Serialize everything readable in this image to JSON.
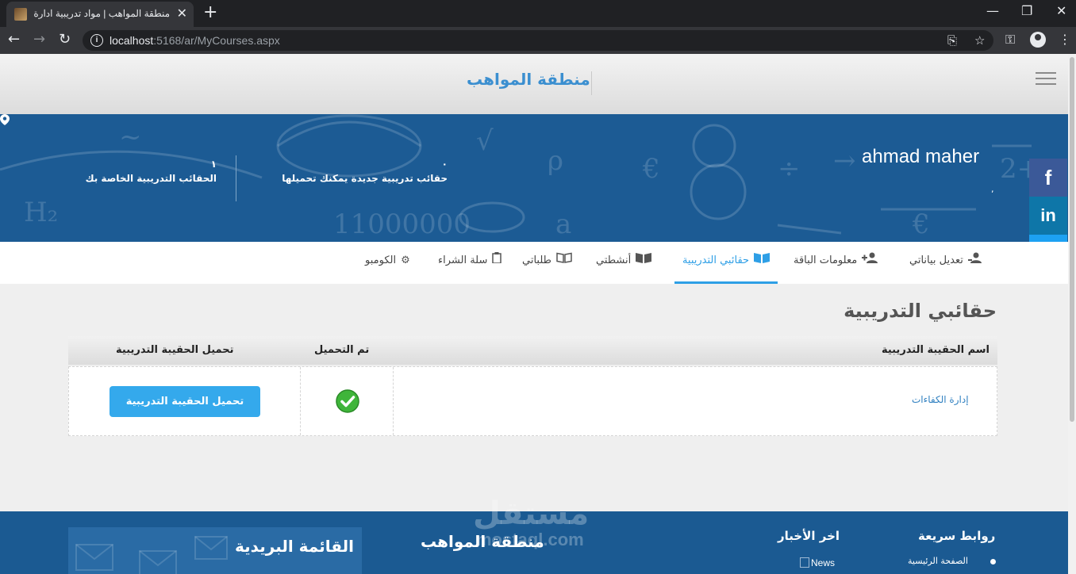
{
  "browser": {
    "tab_title": "منطقة المواهب | مواد تدريبية ادارة",
    "tab_close": "✕",
    "new_tab": "+",
    "url_host": "localhost",
    "url_rest": ":5168/ar/MyCourses.aspx",
    "window_controls": {
      "minimize": "—",
      "maximize": "❐",
      "close": "✕"
    },
    "nav": {
      "back": "←",
      "forward": "→",
      "reload": "↻"
    }
  },
  "site": {
    "logo": "منطقة المواهب"
  },
  "profile": {
    "name": "ahmad maher",
    "location": ",",
    "stats": [
      {
        "value": "٠",
        "label": "حقائب تدريبية جديدة يمكنك تحميلها"
      },
      {
        "value": "١",
        "label": "الحقائب التدريبية الخاصة بك"
      }
    ]
  },
  "social": {
    "facebook": "f",
    "linkedin": "in"
  },
  "nav_tabs": [
    {
      "label": "تعديل بياناتي",
      "icon": "user-edit-icon",
      "active": false
    },
    {
      "label": "معلومات الباقة",
      "icon": "user-plus-icon",
      "active": false
    },
    {
      "label": "حقائبي التدريبية",
      "icon": "open-book-icon",
      "active": true
    },
    {
      "label": "أنشطتي",
      "icon": "book-icon",
      "active": false
    },
    {
      "label": "طلباتي",
      "icon": "book-outline-icon",
      "active": false
    },
    {
      "label": "سلة الشراء",
      "icon": "clipboard-icon",
      "active": false
    },
    {
      "label": "الكومبو",
      "icon": "gear-icon",
      "active": false
    }
  ],
  "main": {
    "title": "حقائبي التدريبية",
    "table": {
      "headers": [
        "اسم الحقيبة التدريبية",
        "تم التحميل",
        "تحميل الحقيبة التدريبية"
      ],
      "rows": [
        {
          "course": "إدارة الكفاءات",
          "downloaded": true,
          "action": "تحميل الحقيبة التدريبية"
        }
      ]
    }
  },
  "footer": {
    "quick_links_title": "روابط سريعة",
    "quick_links": [
      "الصفحة الرئيسية"
    ],
    "news_title": "اخر الأخبار",
    "news_image_alt": "News",
    "brand": "منطقة المواهب",
    "newsletter_title": "القائمة البريدية"
  },
  "watermark": {
    "arabic": "مستقل",
    "latin": "mostaql.com"
  },
  "colors": {
    "accent": "#2e9fe6",
    "banner": "#1c5b94",
    "footer": "#1b5a92",
    "button": "#34a9ec",
    "success": "#3fb53a"
  }
}
